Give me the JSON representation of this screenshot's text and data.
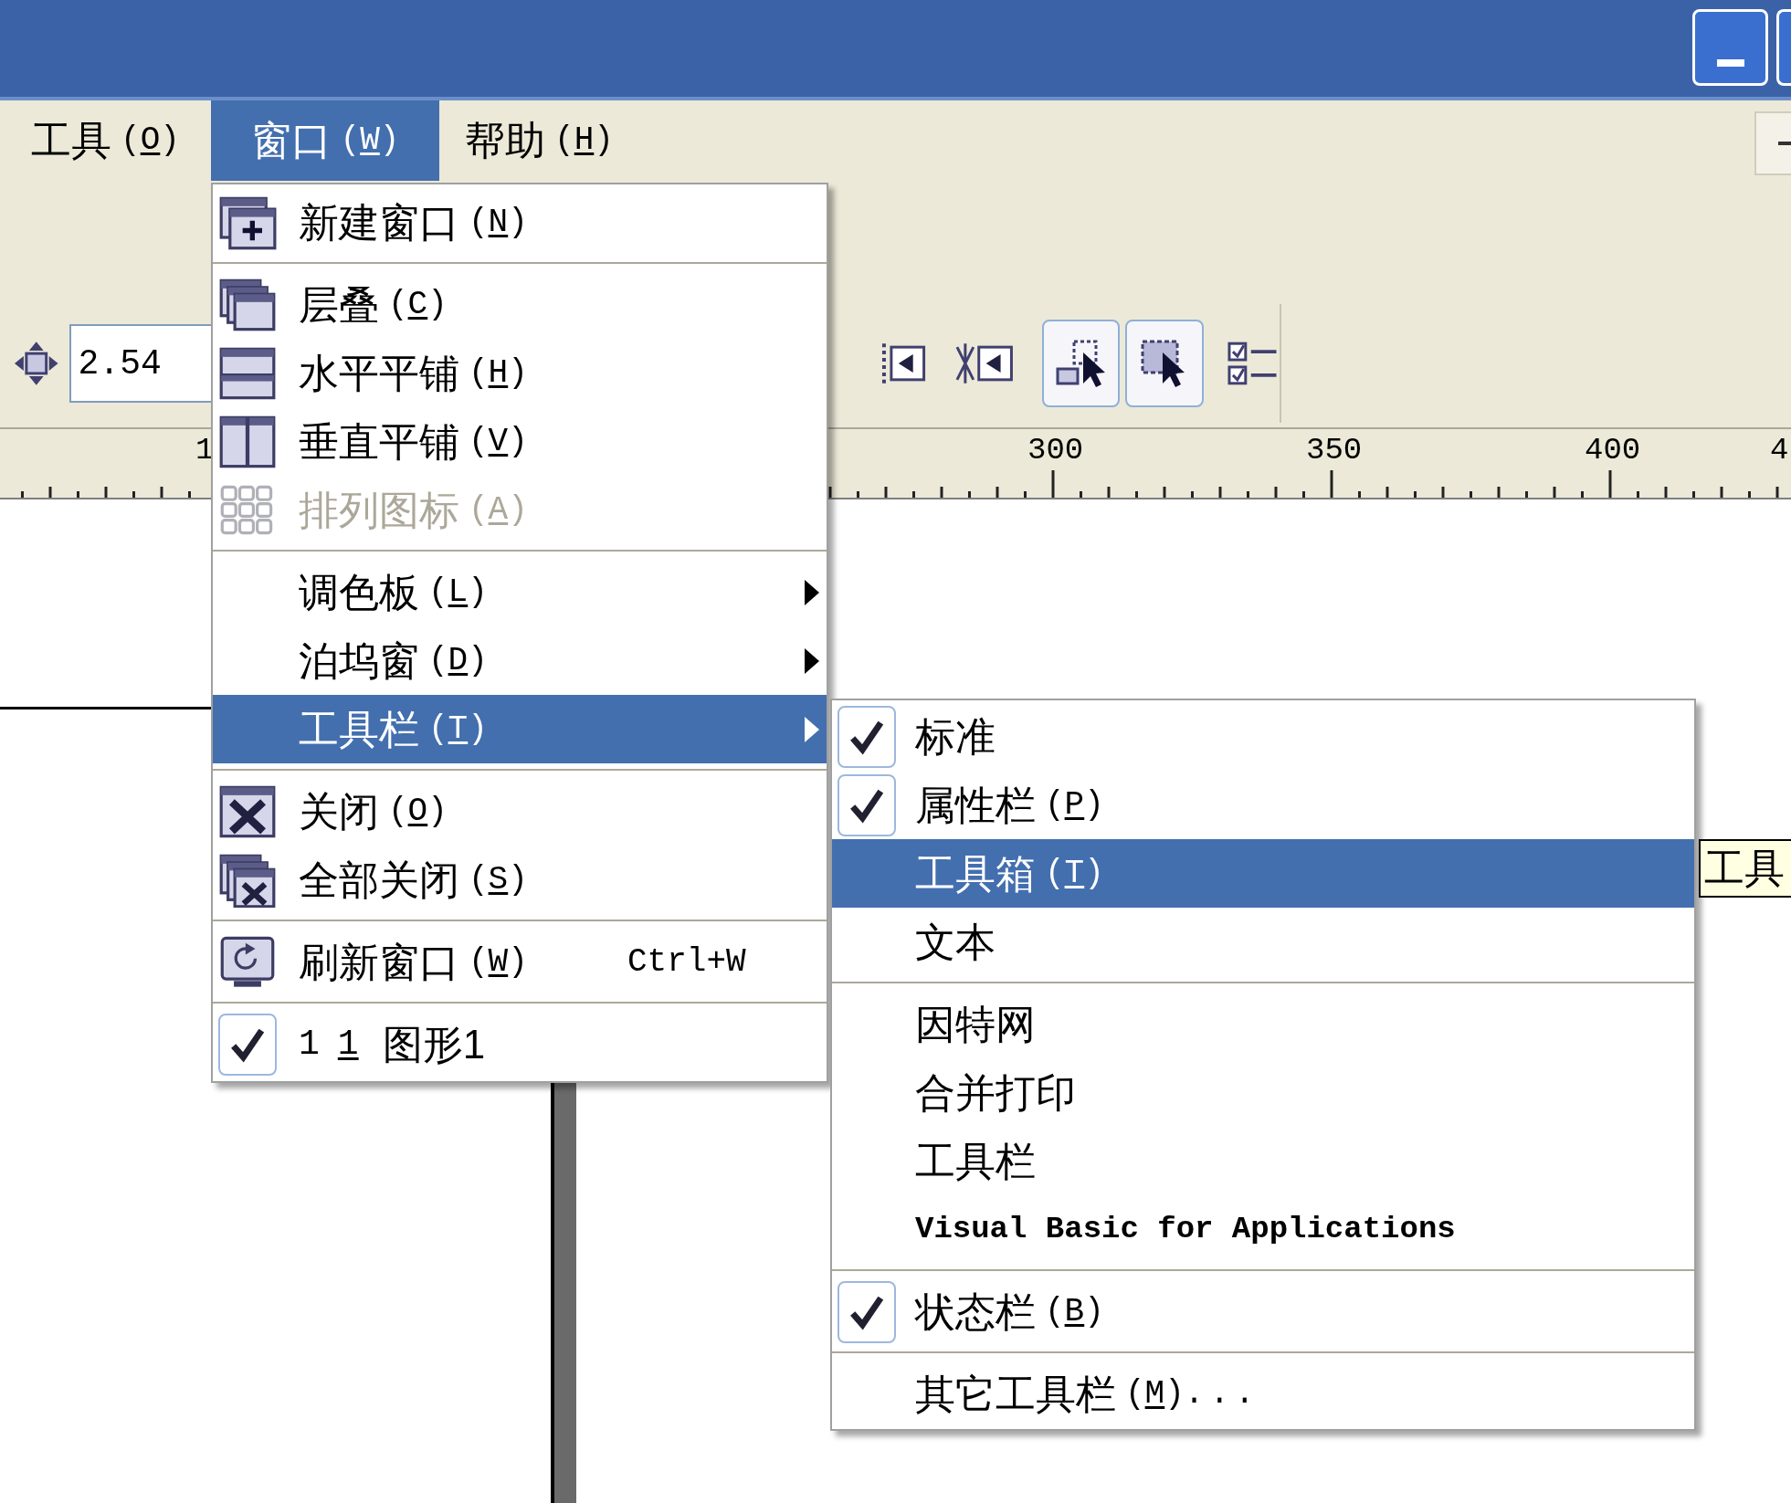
{
  "menubar": [
    {
      "label": "工具",
      "accel": "(O)",
      "selected": false
    },
    {
      "label": "窗口",
      "accel": "(W)",
      "selected": true
    },
    {
      "label": "帮助",
      "accel": "(H)",
      "selected": false
    }
  ],
  "property_bar": {
    "offset_field": {
      "value": "2.54"
    }
  },
  "ruler": {
    "labels": [
      "1",
      "300",
      "350",
      "400",
      "4"
    ]
  },
  "window_menu": {
    "items": [
      {
        "kind": "item",
        "label": "新建窗口",
        "accel": "(N)",
        "checked": false,
        "disabled": false,
        "selected": false,
        "has_submenu": false
      },
      {
        "kind": "separator"
      },
      {
        "kind": "item",
        "label": "层叠",
        "accel": "(C)",
        "checked": false,
        "disabled": false,
        "selected": false,
        "has_submenu": false
      },
      {
        "kind": "item",
        "label": "水平平铺",
        "accel": "(H)",
        "checked": false,
        "disabled": false,
        "selected": false,
        "has_submenu": false
      },
      {
        "kind": "item",
        "label": "垂直平铺",
        "accel": "(V)",
        "checked": false,
        "disabled": false,
        "selected": false,
        "has_submenu": false
      },
      {
        "kind": "item",
        "label": "排列图标",
        "accel": "(A)",
        "checked": false,
        "disabled": true,
        "selected": false,
        "has_submenu": false
      },
      {
        "kind": "separator"
      },
      {
        "kind": "item",
        "label": "调色板",
        "accel": "(L)",
        "checked": false,
        "disabled": false,
        "selected": false,
        "has_submenu": true
      },
      {
        "kind": "item",
        "label": "泊坞窗",
        "accel": "(D)",
        "checked": false,
        "disabled": false,
        "selected": false,
        "has_submenu": true
      },
      {
        "kind": "item",
        "label": "工具栏",
        "accel": "(T)",
        "checked": false,
        "disabled": false,
        "selected": true,
        "has_submenu": true
      },
      {
        "kind": "separator"
      },
      {
        "kind": "item",
        "label": "关闭",
        "accel": "(O)",
        "checked": false,
        "disabled": false,
        "selected": false,
        "has_submenu": false
      },
      {
        "kind": "item",
        "label": "全部关闭",
        "accel": "(S)",
        "checked": false,
        "disabled": false,
        "selected": false,
        "has_submenu": false
      },
      {
        "kind": "separator"
      },
      {
        "kind": "item",
        "label": "刷新窗口",
        "accel": "(W)",
        "shortcut": "Ctrl+W",
        "checked": false,
        "disabled": false,
        "selected": false,
        "has_submenu": false
      },
      {
        "kind": "separator"
      },
      {
        "kind": "document",
        "number": "1",
        "mnemonic": "1",
        "label": "图形1",
        "checked": true,
        "disabled": false,
        "selected": false,
        "has_submenu": false
      }
    ]
  },
  "toolbars_submenu": {
    "items": [
      {
        "kind": "item",
        "label": "标准",
        "checked": true,
        "selected": false
      },
      {
        "kind": "item",
        "label": "属性栏",
        "accel": "(P)",
        "checked": true,
        "selected": false
      },
      {
        "kind": "item",
        "label": "工具箱",
        "accel": "(T)",
        "checked": false,
        "selected": true
      },
      {
        "kind": "item",
        "label": "文本",
        "checked": false,
        "selected": false
      },
      {
        "kind": "separator"
      },
      {
        "kind": "item",
        "label": "因特网",
        "checked": false,
        "selected": false
      },
      {
        "kind": "item",
        "label": "合并打印",
        "checked": false,
        "selected": false
      },
      {
        "kind": "item",
        "label": "工具栏",
        "checked": false,
        "selected": false
      },
      {
        "kind": "item",
        "label": "Visual Basic for Applications",
        "latin": true,
        "checked": false,
        "selected": false
      },
      {
        "kind": "separator"
      },
      {
        "kind": "item",
        "label": "状态栏",
        "accel": "(B)",
        "checked": true,
        "selected": false
      },
      {
        "kind": "separator"
      },
      {
        "kind": "item",
        "label": "其它工具栏",
        "accel": "(M)",
        "suffix": "...",
        "checked": false,
        "selected": false
      }
    ]
  },
  "tooltip": {
    "text": "工具"
  }
}
